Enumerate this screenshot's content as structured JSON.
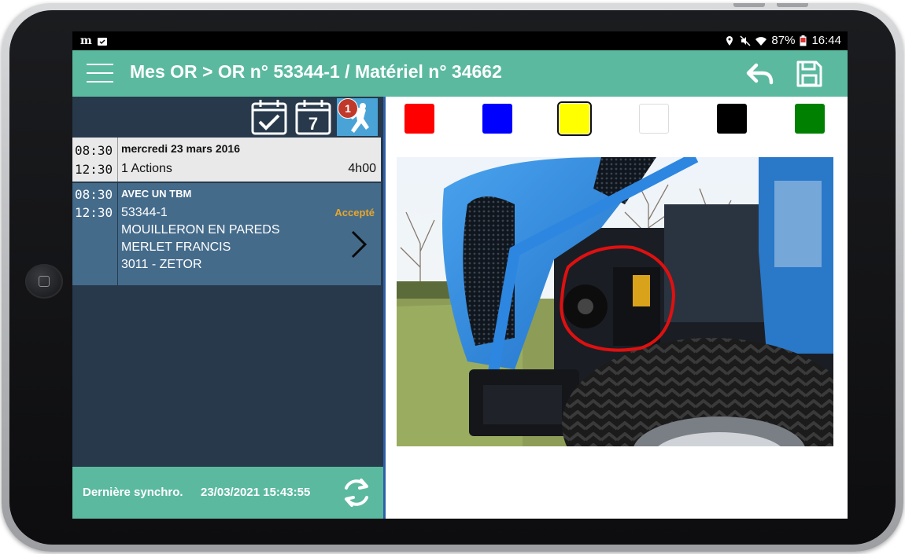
{
  "status_bar": {
    "left_icons": [
      "newspaper-icon",
      "notification-icon"
    ],
    "right_icons": [
      "location-icon",
      "mute-icon",
      "wifi-icon",
      "battery-icon"
    ],
    "battery": "87%",
    "time": "16:44"
  },
  "appbar": {
    "title": "Mes OR > OR n° 53344-1 / Matériel n° 34662",
    "menu_icon": "hamburger-menu-icon",
    "back_icon": "back-arrow-icon",
    "save_icon": "save-floppy-icon"
  },
  "tabs": [
    {
      "icon": "calendar-check-icon"
    },
    {
      "icon": "calendar-7-icon",
      "label": "7"
    },
    {
      "icon": "tasks-badge-icon",
      "badge": "1"
    }
  ],
  "agenda": {
    "day": {
      "start": "08:30",
      "end": "12:30",
      "date": "mercredi 23 mars 2016",
      "actions": "1 Actions",
      "duration": "4h00"
    },
    "task": {
      "start": "08:30",
      "end": "12:30",
      "name": "AVEC UN TBM",
      "status": "Accepté",
      "lines": [
        "53344-1",
        "MOUILLERON EN PAREDS",
        "MERLET FRANCIS",
        "3011 - ZETOR"
      ]
    }
  },
  "sync": {
    "label": "Dernière synchro.",
    "datetime": "23/03/2021 15:43:55",
    "icon": "sync-icon"
  },
  "colors": {
    "accent": "#5bb99f",
    "panel": "#27394b",
    "task_bg": "#456b8b",
    "status": "#e8a72b"
  },
  "palette": [
    {
      "name": "red",
      "hex": "#ff0000",
      "selected": false
    },
    {
      "name": "blue",
      "hex": "#0000ff",
      "selected": false
    },
    {
      "name": "yellow",
      "hex": "#ffff00",
      "selected": true
    },
    {
      "name": "white",
      "hex": "#ffffff",
      "selected": false
    },
    {
      "name": "black",
      "hex": "#000000",
      "selected": false
    },
    {
      "name": "green",
      "hex": "#008000",
      "selected": false
    }
  ],
  "photo": {
    "subject": "tractor-engine-photo",
    "annotation_color": "#e01010"
  }
}
